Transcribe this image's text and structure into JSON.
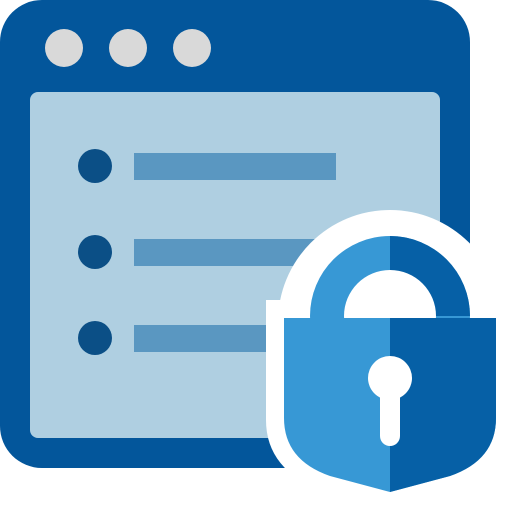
{
  "icon": {
    "name": "secure-browser-window-with-padlock",
    "window_controls": [
      "window-dot-icon",
      "window-dot-icon",
      "window-dot-icon"
    ],
    "list_rows": [
      "bullet-icon",
      "bullet-icon",
      "bullet-icon"
    ],
    "overlay": "padlock-icon"
  },
  "colors": {
    "window_frame": "#03569B",
    "window_content": "#AFCFE1",
    "window_dot": "#D9D9D9",
    "bullet": "#0B4F86",
    "list_line": "#5A97C1",
    "padlock_light": "#3798D5",
    "padlock_dark": "#0660A6",
    "padlock_outline": "#FFFFFF",
    "keyhole": "#FFFFFF"
  }
}
